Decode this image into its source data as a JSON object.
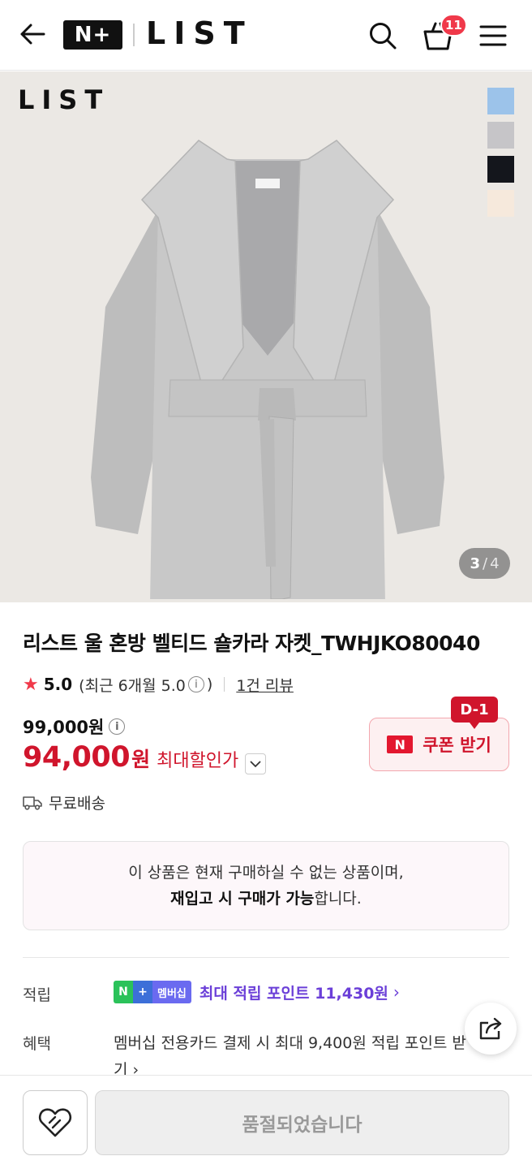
{
  "header": {
    "logo_text": "N+",
    "brand": "LIST",
    "cart_count": "11",
    "icons": [
      "back-arrow-icon",
      "search-icon",
      "cart-icon",
      "menu-icon"
    ]
  },
  "hero": {
    "brand_watermark": "LIST",
    "page_current": "3",
    "page_separator": "/",
    "page_total": "4",
    "swatches": [
      "#9cc3ea",
      "#c6c5c8",
      "#14161c",
      "#f6e9dc"
    ]
  },
  "product": {
    "title": "리스트 울 혼방 벨티드 숄카라 자켓_TWHJKO80040",
    "rating": "5.0",
    "recent_rating_prefix": "(최근 6개월 5.0",
    "recent_rating_suffix": ")",
    "review_link": "1건 리뷰",
    "original_price": "99,000원",
    "sale_price": "94,000",
    "sale_unit": "원",
    "sale_label": "최대할인가",
    "coupon_logo": "N",
    "coupon_label": "쿠폰 받기",
    "coupon_badge": "D-1",
    "shipping": "무료배송"
  },
  "notice": {
    "line1": "이 상품은 현재 구매하실 수 없는 상품이며,",
    "line2_bold": "재입고 시 구매가 가능",
    "line2_rest": "합니다."
  },
  "benefits": {
    "points_label": "적립",
    "badge_n": "N",
    "badge_plus": "+",
    "badge_membership": "멤버십",
    "points_text": "최대 적립 포인트 11,430원",
    "benefit_label": "혜택",
    "benefit_text": "멤버십 전용카드 결제 시 최대 9,400원 적립 포인트 받기"
  },
  "bottom": {
    "soldout_label": "품절되었습니다"
  },
  "colors": {
    "accent_red": "#d0152c",
    "badge_red": "#f0394a",
    "points_purple": "#6b3fd8"
  }
}
